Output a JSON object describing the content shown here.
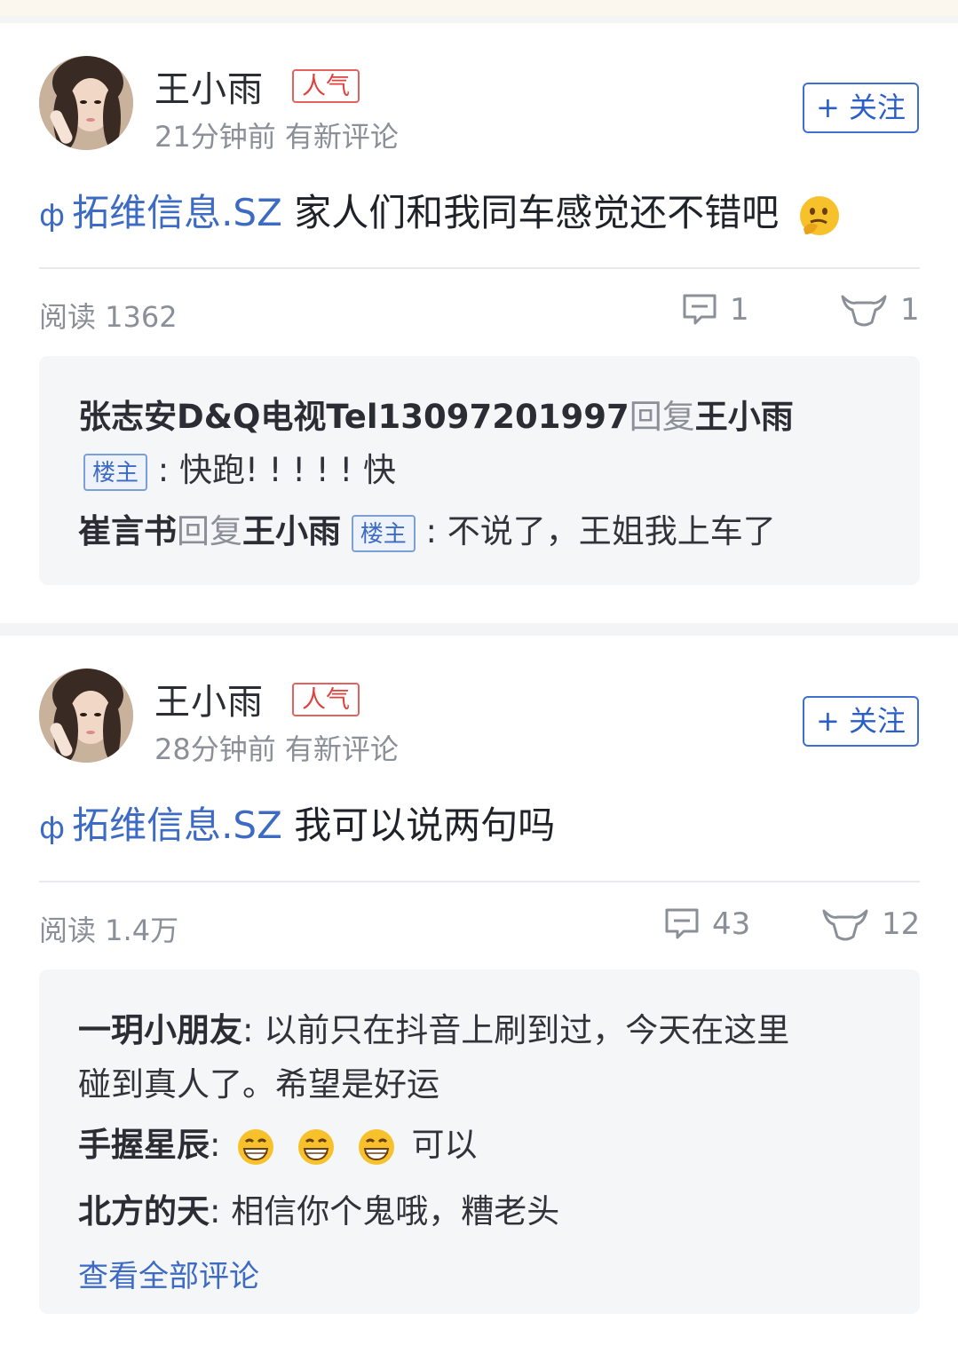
{
  "posts": [
    {
      "author": "王小雨",
      "badge": "人气",
      "meta": "21分钟前 有新评论",
      "follow_label": "+ 关注",
      "stock_icon": "ф",
      "stock": "拓维信息.SZ",
      "text": "家人们和我同车感觉还不错吧",
      "text_emoji": "thinking-face",
      "reads": "阅读 1362",
      "comments": "1",
      "likes": "1",
      "replies": {
        "r1_name": "张志安D&Q电视Tel13097201997",
        "r1_reply": "回复",
        "r1_to": "王小雨",
        "r1_tag": "楼主",
        "r1_text": ": 快跑! ! ! ! ! 快",
        "r2_name": "崔言书",
        "r2_reply": "回复",
        "r2_to": "王小雨",
        "r2_tag": "楼主",
        "r2_text": ": 不说了，王姐我上车了"
      }
    },
    {
      "author": "王小雨",
      "badge": "人气",
      "meta": "28分钟前 有新评论",
      "follow_label": "+ 关注",
      "stock_icon": "ф",
      "stock": "拓维信息.SZ",
      "text": "我可以说两句吗",
      "reads": "阅读 1.4万",
      "comments": "43",
      "likes": "12",
      "replies": {
        "c1_name": "一玥小朋友",
        "c1_text_a": ": 以前只在抖音上刷到过，今天在这里",
        "c1_text_b": "碰到真人了。希望是好运",
        "c2_name": "手握星辰",
        "c2_sep": ":",
        "c2_emojis": [
          "grin-emoji",
          "grin-emoji",
          "grin-emoji"
        ],
        "c2_text": "可以",
        "c3_name": "北方的天",
        "c3_text": ": 相信你个鬼哦，糟老头",
        "view_all": "查看全部评论"
      }
    }
  ],
  "colors": {
    "link": "#3d6bc4",
    "badge_red": "#e0413c",
    "muted": "#8a8f98",
    "follow_blue": "#2b5fc7"
  }
}
